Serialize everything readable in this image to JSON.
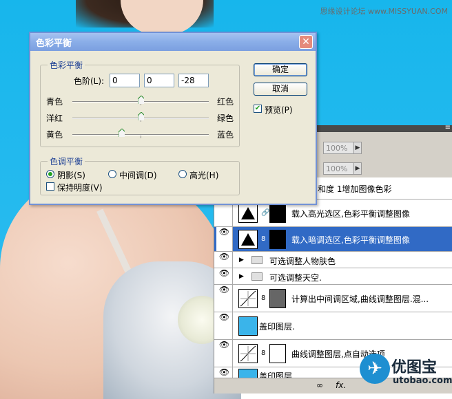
{
  "watermark_top": "思缘设计论坛 www.MISSYUAN.COM",
  "dialog": {
    "title": "色彩平衡",
    "close_glyph": "✕",
    "color_balance": {
      "group_title": "色彩平衡",
      "levels_label": "色阶(L):",
      "values": [
        "0",
        "0",
        "-28"
      ],
      "sliders": [
        {
          "left": "青色",
          "right": "红色",
          "value": 0
        },
        {
          "left": "洋红",
          "right": "绿色",
          "value": 0
        },
        {
          "left": "黄色",
          "right": "蓝色",
          "value": -28
        }
      ]
    },
    "tone_balance": {
      "group_title": "色调平衡",
      "options": [
        "阴影(S)",
        "中间调(D)",
        "高光(H)"
      ],
      "selected": "阴影(S)",
      "preserve_luminosity": "保持明度(V)",
      "preserve_checked": false
    },
    "ok": "确定",
    "cancel": "取消",
    "preview": "预览(P)",
    "preview_checked": true
  },
  "layers_panel": {
    "opacity": "100%",
    "fill": "100%",
    "layers": [
      {
        "name": "和度 1增加图像色彩",
        "visible": false,
        "type": "partial"
      },
      {
        "name": "载入高光选区,色彩平衡调整图像",
        "visible": false,
        "type": "adjust"
      },
      {
        "name": "载入暗调选区,色彩平衡调整图像",
        "visible": true,
        "type": "adjust",
        "selected": true
      },
      {
        "name": "可选调整人物肤色",
        "visible": true,
        "type": "group"
      },
      {
        "name": "可选调整天空.",
        "visible": true,
        "type": "group"
      },
      {
        "name": "计算出中间调区域,曲线调整图层.混...",
        "visible": true,
        "type": "curves"
      },
      {
        "name": "盖印图层.",
        "visible": true,
        "type": "image"
      },
      {
        "name": "曲线调整图层,点自动选项",
        "visible": true,
        "type": "curves"
      },
      {
        "name": "盖印图层",
        "visible": true,
        "type": "image"
      }
    ],
    "bottom_icons": [
      "link-icon",
      "fx-icon"
    ]
  },
  "logo": {
    "text": "优图宝",
    "url": "utobao.com"
  }
}
